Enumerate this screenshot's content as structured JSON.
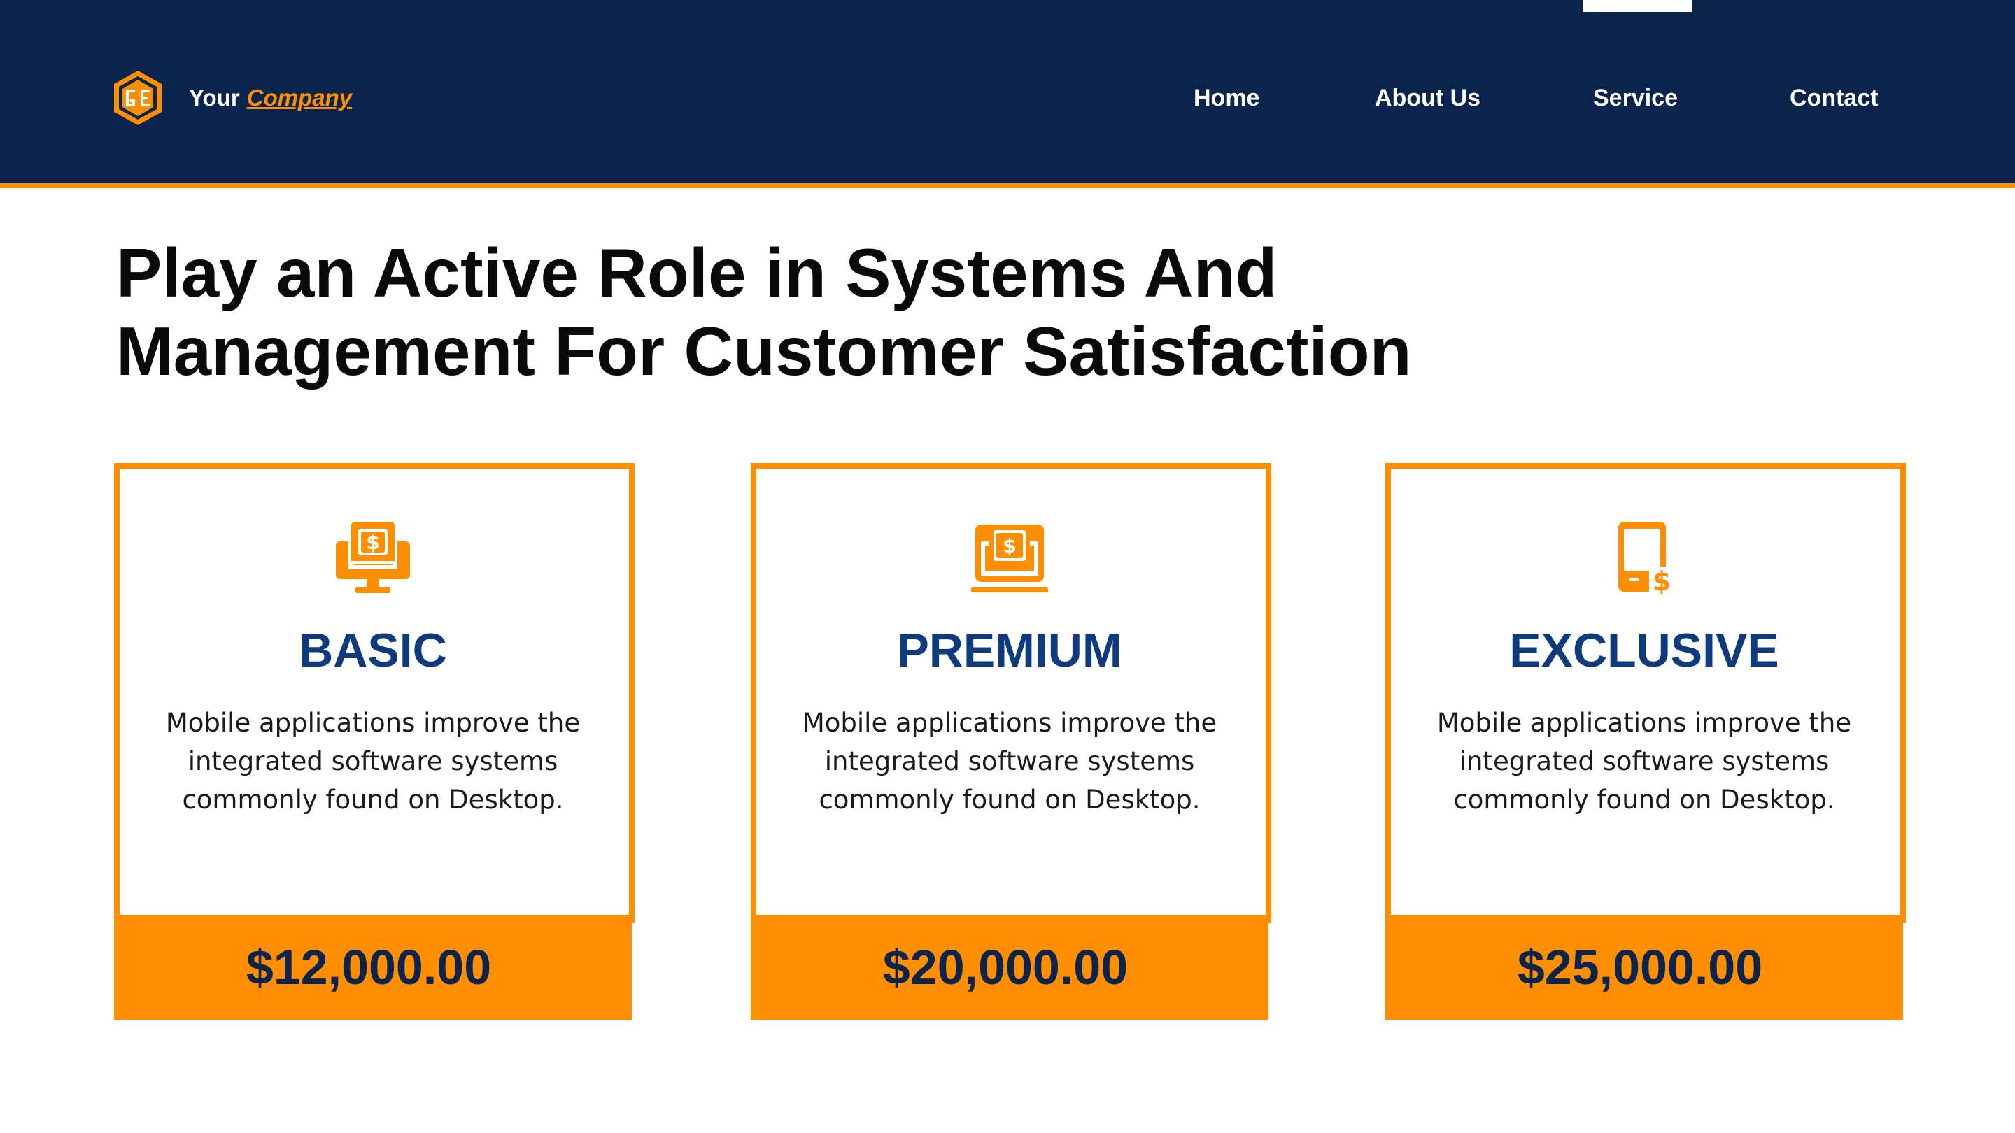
{
  "brand": {
    "prefix": "Your",
    "highlight": "Company"
  },
  "nav": {
    "items": [
      {
        "label": "Home"
      },
      {
        "label": "About Us"
      },
      {
        "label": "Service"
      },
      {
        "label": "Contact"
      }
    ],
    "active": "Service"
  },
  "headline": {
    "line1": "Play an Active Role in Systems And",
    "line2": "Management For Customer Satisfaction"
  },
  "cards": [
    {
      "icon": "monitor-dollar-icon",
      "title": "BASIC",
      "description": "Mobile applications improve the integrated software systems commonly found on Desktop.",
      "price": "$12,000.00"
    },
    {
      "icon": "laptop-dollar-icon",
      "title": "PREMIUM",
      "description": "Mobile applications improve the integrated software systems commonly found on Desktop.",
      "price": "$20,000.00"
    },
    {
      "icon": "tablet-dollar-icon",
      "title": "EXCLUSIVE",
      "description": "Mobile applications improve the integrated software systems commonly found on Desktop.",
      "price": "$25,000.00"
    }
  ],
  "colors": {
    "navy": "#0b244d",
    "accent": "#ff8f00",
    "title_blue": "#0e3a80"
  }
}
